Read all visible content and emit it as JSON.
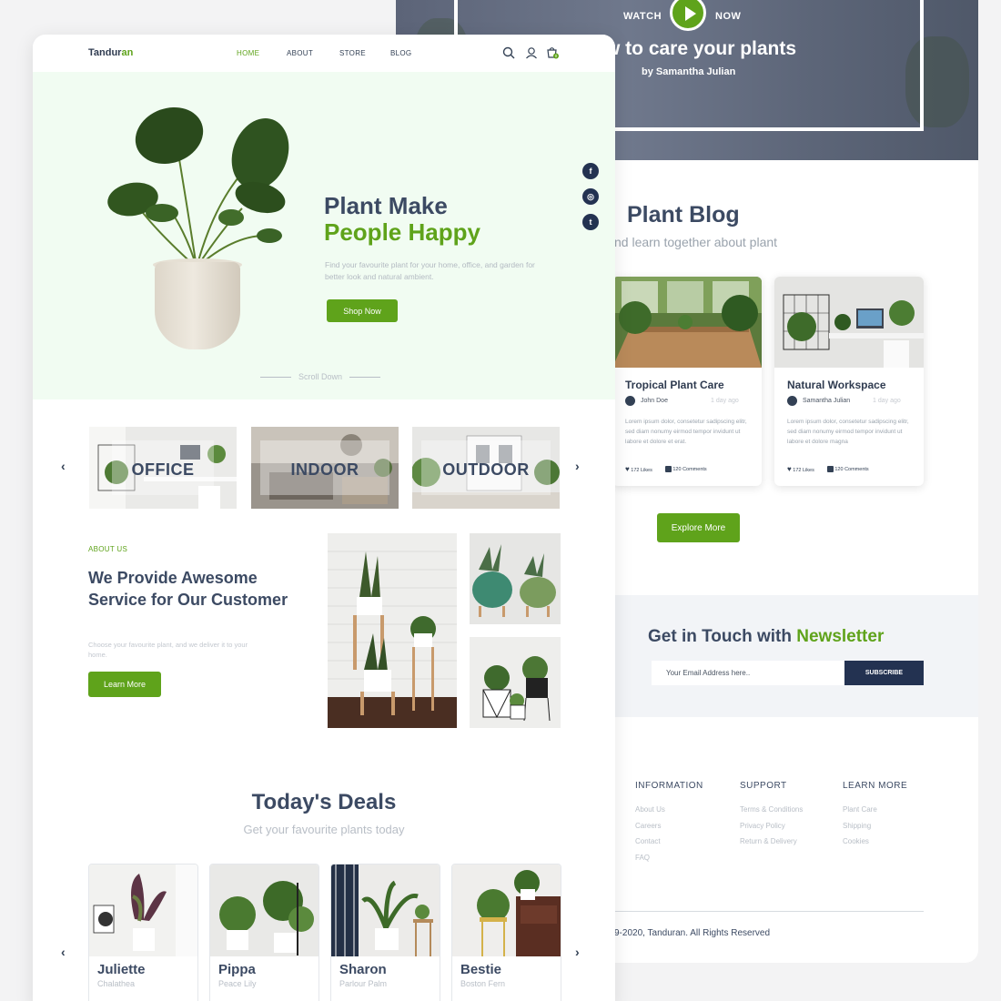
{
  "blog_page": {
    "video": {
      "watch_label": "WATCH",
      "now_label": "NOW",
      "title": "w to care your plants",
      "author": "by Samantha Julian"
    },
    "blog": {
      "title": "Plant Blog",
      "subtitle": "nd learn together about plant"
    },
    "posts": [
      {
        "title": "Tropical Plant Care",
        "author": "John Doe",
        "time": "1 day ago",
        "excerpt": "Lorem ipsum dolor, consetetur sadipscing elitr, sed diam nonumy eirmod tempor invidunt ut labore et dolore et erat.",
        "likes": "172 Likes",
        "comments": "120 Comments"
      },
      {
        "title": "Natural Workspace",
        "author": "Samantha Julian",
        "time": "1 day ago",
        "excerpt": "Lorem ipsum dolor, consetetur sadipscing elitr, sed diam nonumy eirmod tempor invidunt ut labore et dolore magna",
        "likes": "172 Likes",
        "comments": "120 Comments"
      }
    ],
    "explore_label": "Explore More",
    "newsletter": {
      "title_main": "Get in Touch with",
      "title_accent": "Newsletter",
      "placeholder": "Your Email Address here..",
      "button": "SUBSCRIBE"
    },
    "footer": {
      "columns": [
        {
          "heading": "INFORMATION",
          "links": [
            "About Us",
            "Careers",
            "Contact",
            "FAQ"
          ]
        },
        {
          "heading": "SUPPORT",
          "links": [
            "Terms & Conditions",
            "Privacy Policy",
            "Return & Delivery"
          ]
        },
        {
          "heading": "LEARN MORE",
          "links": [
            "Plant Care",
            "Shipping",
            "Cookies"
          ]
        }
      ],
      "copyright": "9-2020, Tanduran. All Rights Reserved"
    }
  },
  "home_page": {
    "logo": {
      "main": "Tandur",
      "accent": "an"
    },
    "nav": [
      "HOME",
      "ABOUT",
      "STORE",
      "BLOG"
    ],
    "cart_count": "0",
    "hero": {
      "title_line1": "Plant Make",
      "title_line2": "People Happy",
      "description": "Find your favourite plant for your home, office, and garden for better look and natural ambient.",
      "cta": "Shop Now",
      "scroll": "Scroll Down"
    },
    "social": [
      "f",
      "◎",
      "t"
    ],
    "categories": [
      "OFFICE",
      "INDOOR",
      "OUTDOOR"
    ],
    "about": {
      "tag": "ABOUT US",
      "title": "We Provide Awesome Service for Our Customer",
      "description": "Choose your favourite plant, and we deliver it to your home.",
      "cta": "Learn More"
    },
    "deals": {
      "title": "Today's Deals",
      "subtitle": "Get your favourite plants today",
      "items": [
        {
          "name": "Juliette",
          "species": "Chalathea"
        },
        {
          "name": "Pippa",
          "species": "Peace Lily"
        },
        {
          "name": "Sharon",
          "species": "Parlour Palm"
        },
        {
          "name": "Bestie",
          "species": "Boston Fern"
        }
      ]
    }
  },
  "colors": {
    "brand_green": "#5fa31b",
    "navy": "#233251",
    "heading": "#3c4a63",
    "hero_bg": "#f1fcf2"
  },
  "icons": [
    "play-icon",
    "search-icon",
    "user-icon",
    "cart-icon",
    "facebook-icon",
    "instagram-icon",
    "twitter-icon",
    "heart-icon",
    "comment-icon",
    "chevron-left-icon",
    "chevron-right-icon"
  ]
}
